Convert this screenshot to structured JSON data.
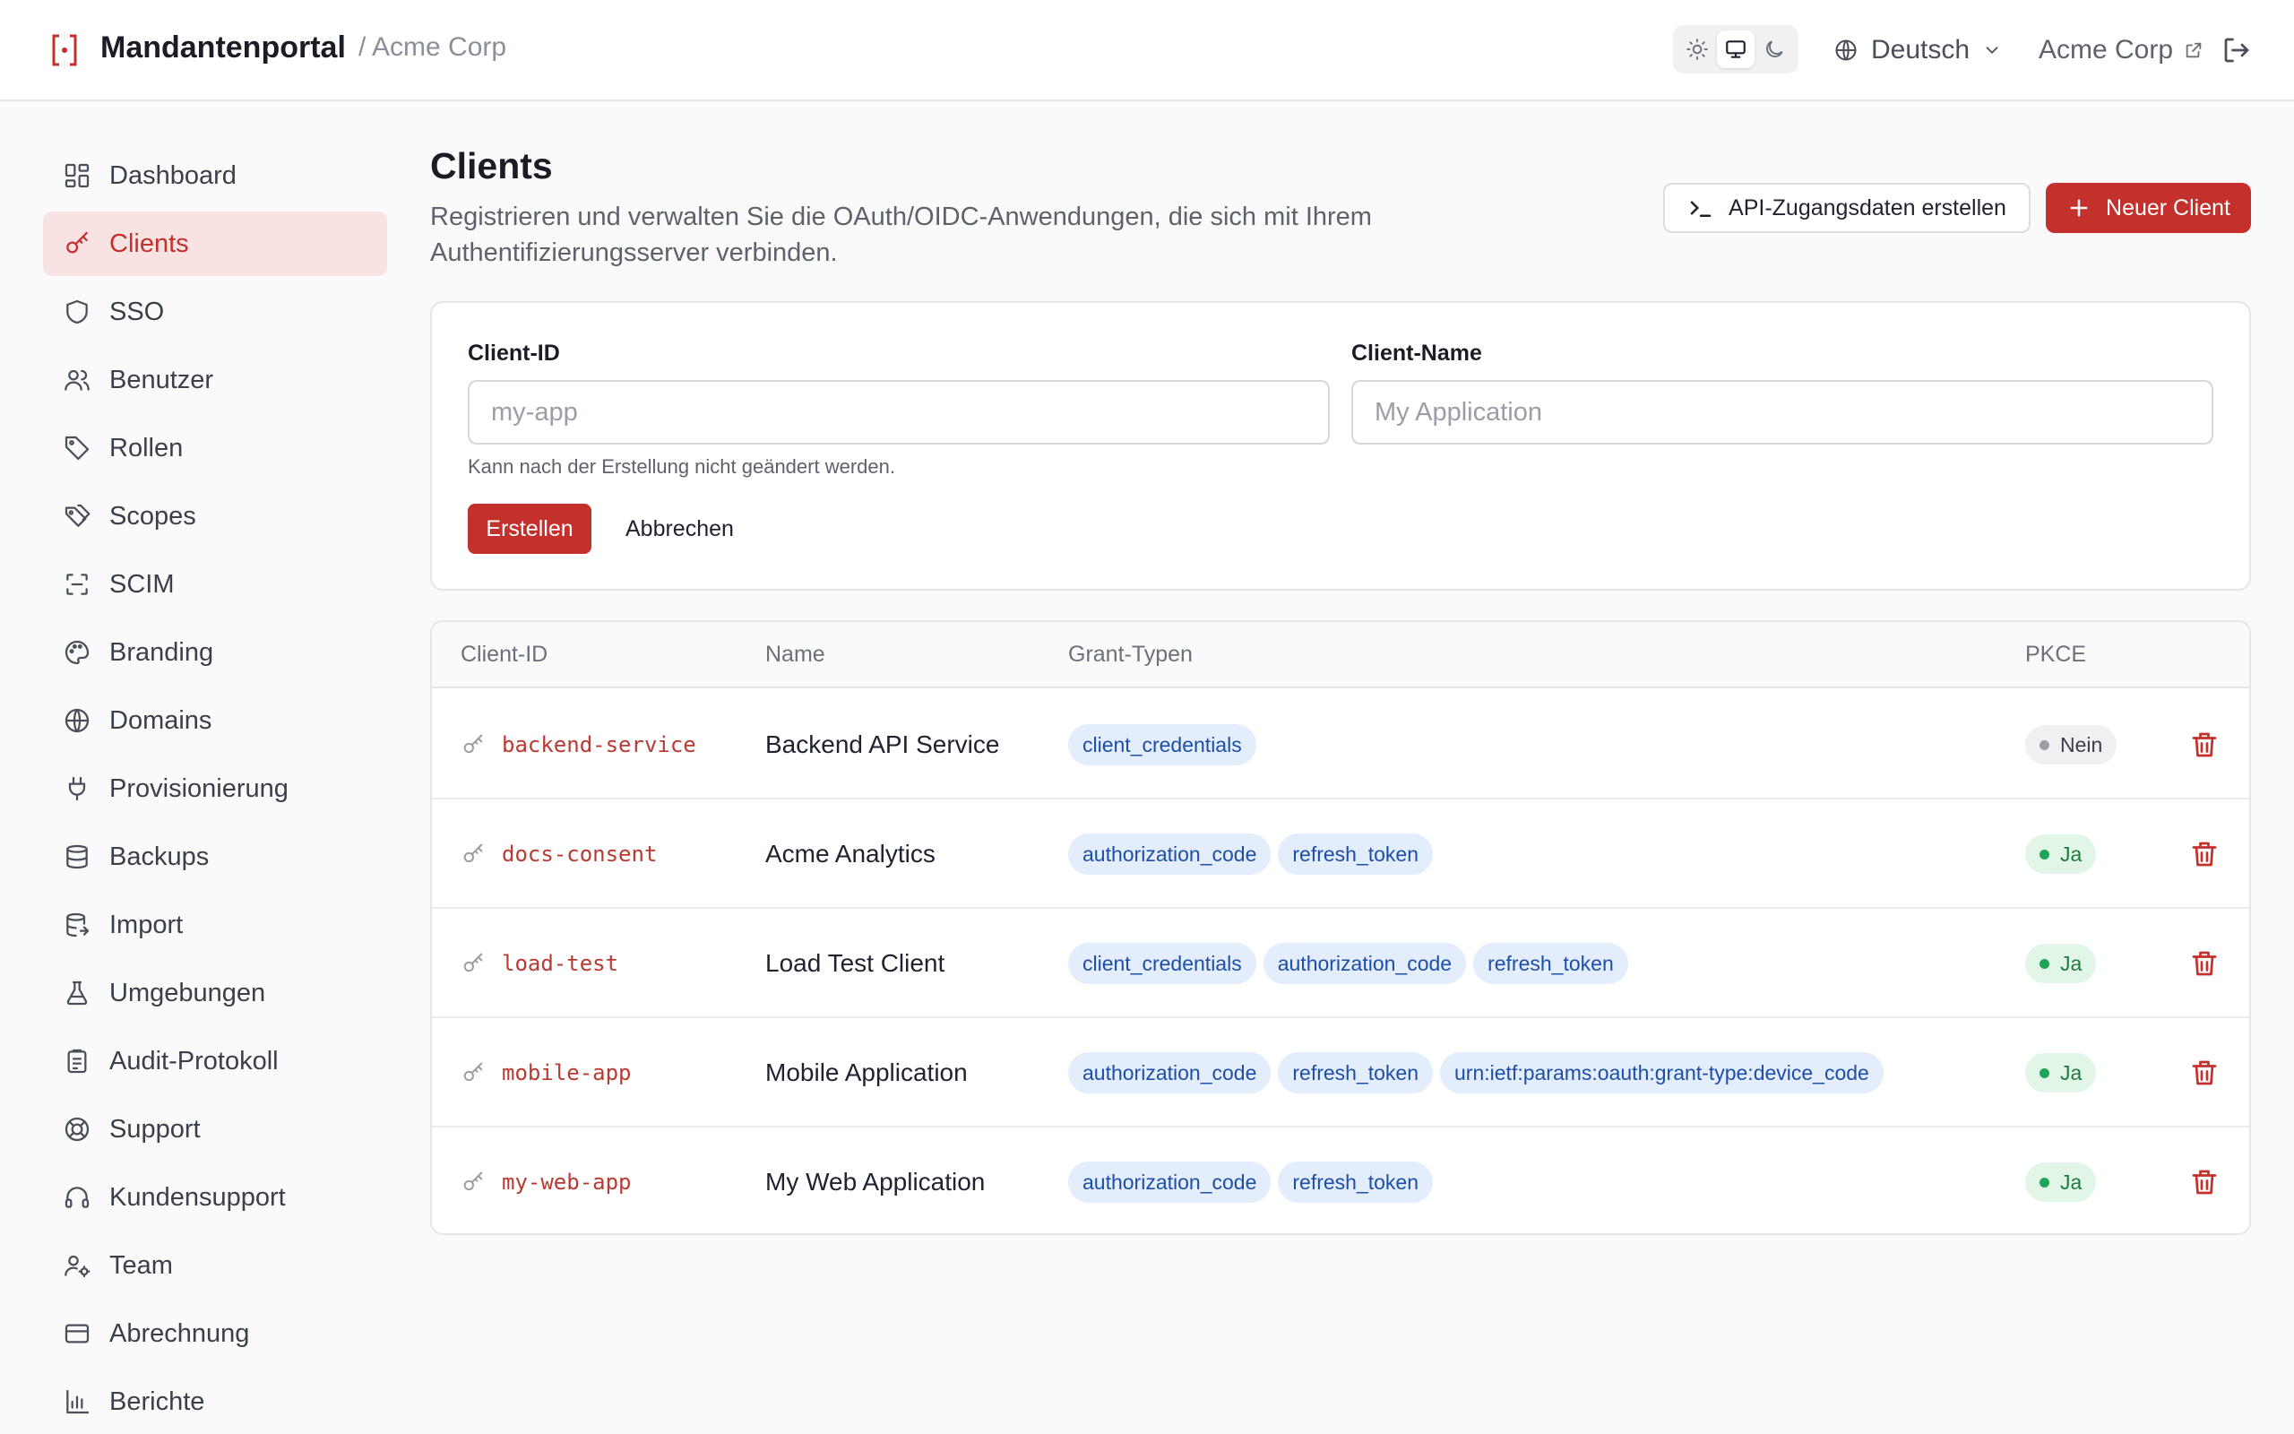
{
  "header": {
    "app_name": "Mandantenportal",
    "breadcrumb_org": "/ Acme Corp",
    "language": "Deutsch",
    "org_name": "Acme Corp"
  },
  "sidebar": {
    "items": [
      {
        "label": "Dashboard",
        "icon": "dashboard-icon"
      },
      {
        "label": "Clients",
        "icon": "key-icon"
      },
      {
        "label": "SSO",
        "icon": "shield-icon"
      },
      {
        "label": "Benutzer",
        "icon": "users-icon"
      },
      {
        "label": "Rollen",
        "icon": "tag-icon"
      },
      {
        "label": "Scopes",
        "icon": "tags-icon"
      },
      {
        "label": "SCIM",
        "icon": "scan-icon"
      },
      {
        "label": "Branding",
        "icon": "palette-icon"
      },
      {
        "label": "Domains",
        "icon": "globe-icon"
      },
      {
        "label": "Provisionierung",
        "icon": "plug-icon"
      },
      {
        "label": "Backups",
        "icon": "database-icon"
      },
      {
        "label": "Import",
        "icon": "database-import-icon"
      },
      {
        "label": "Umgebungen",
        "icon": "flask-icon"
      },
      {
        "label": "Audit-Protokoll",
        "icon": "clipboard-icon"
      },
      {
        "label": "Support",
        "icon": "lifebuoy-icon"
      },
      {
        "label": "Kundensupport",
        "icon": "headset-icon"
      },
      {
        "label": "Team",
        "icon": "user-cog-icon"
      },
      {
        "label": "Abrechnung",
        "icon": "credit-card-icon"
      },
      {
        "label": "Berichte",
        "icon": "bar-chart-icon"
      }
    ],
    "active_index": 1
  },
  "page": {
    "title": "Clients",
    "subtitle": "Registrieren und verwalten Sie die OAuth/OIDC-Anwendungen, die sich mit Ihrem Authentifizierungsserver verbinden.",
    "api_button_label": "API-Zugangsdaten erstellen",
    "new_client_label": "Neuer Client"
  },
  "form": {
    "client_id_label": "Client-ID",
    "client_id_placeholder": "my-app",
    "client_id_value": "",
    "client_name_label": "Client-Name",
    "client_name_placeholder": "My Application",
    "client_name_value": "",
    "hint": "Kann nach der Erstellung nicht geändert werden.",
    "create_label": "Erstellen",
    "cancel_label": "Abbrechen"
  },
  "table": {
    "headers": {
      "client_id": "Client-ID",
      "name": "Name",
      "grants": "Grant-Typen",
      "pkce": "PKCE"
    },
    "rows": [
      {
        "client_id": "backend-service",
        "name": "Backend API Service",
        "grants": [
          "client_credentials"
        ],
        "pkce": "Nein",
        "pkce_enabled": false
      },
      {
        "client_id": "docs-consent",
        "name": "Acme Analytics",
        "grants": [
          "authorization_code",
          "refresh_token"
        ],
        "pkce": "Ja",
        "pkce_enabled": true
      },
      {
        "client_id": "load-test",
        "name": "Load Test Client",
        "grants": [
          "client_credentials",
          "authorization_code",
          "refresh_token"
        ],
        "pkce": "Ja",
        "pkce_enabled": true
      },
      {
        "client_id": "mobile-app",
        "name": "Mobile Application",
        "grants": [
          "authorization_code",
          "refresh_token",
          "urn:ietf:params:oauth:grant-type:device_code"
        ],
        "pkce": "Ja",
        "pkce_enabled": true
      },
      {
        "client_id": "my-web-app",
        "name": "My Web Application",
        "grants": [
          "authorization_code",
          "refresh_token"
        ],
        "pkce": "Ja",
        "pkce_enabled": true
      }
    ]
  },
  "colors": {
    "accent": "#c4302b",
    "chip_bg": "#e3edfb",
    "chip_text": "#1d4fa8",
    "pkce_yes_bg": "#e2f6e8",
    "pkce_yes_text": "#1f7a3d"
  }
}
